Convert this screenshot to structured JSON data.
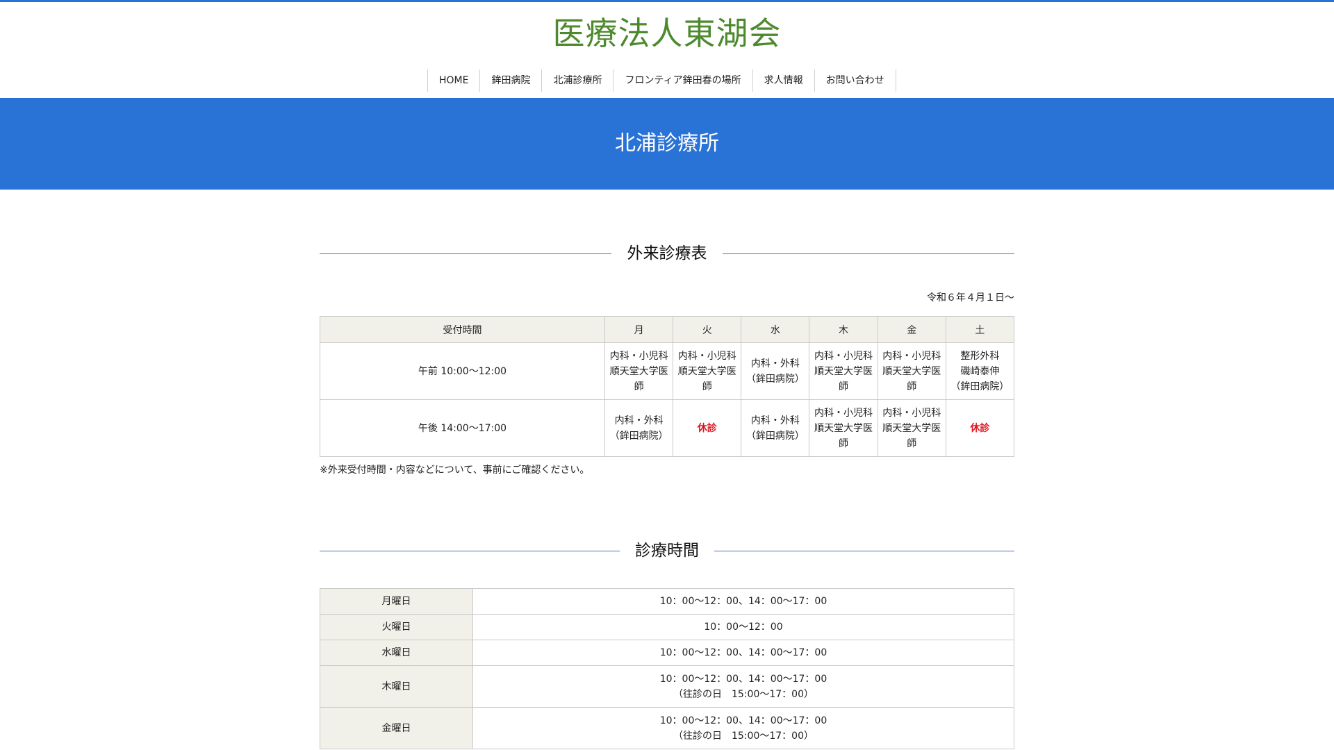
{
  "site": {
    "logo": "医療法人東湖会"
  },
  "nav": [
    "HOME",
    "鉾田病院",
    "北浦診療所",
    "フロンティア鉾田春の場所",
    "求人情報",
    "お問い合わせ"
  ],
  "hero": {
    "title": "北浦診療所"
  },
  "schedule": {
    "heading": "外来診療表",
    "effective_date": "令和６年４月１日～",
    "columns": [
      "受付時間",
      "月",
      "火",
      "水",
      "木",
      "金",
      "土"
    ],
    "rows": [
      {
        "time": "午前 10:00～12:00",
        "cells": [
          {
            "text": "内科・小児科\n順天堂大学医\n師",
            "closed": false
          },
          {
            "text": "内科・小児科\n順天堂大学医\n師",
            "closed": false
          },
          {
            "text": "内科・外科\n（鉾田病院）",
            "closed": false
          },
          {
            "text": "内科・小児科\n順天堂大学医\n師",
            "closed": false
          },
          {
            "text": "内科・小児科\n順天堂大学医\n師",
            "closed": false
          },
          {
            "text": "整形外科\n磯崎泰伸\n（鉾田病院）",
            "closed": false
          }
        ]
      },
      {
        "time": "午後 14:00～17:00",
        "cells": [
          {
            "text": "内科・外科\n（鉾田病院）",
            "closed": false
          },
          {
            "text": "休診",
            "closed": true
          },
          {
            "text": "内科・外科\n（鉾田病院）",
            "closed": false
          },
          {
            "text": "内科・小児科\n順天堂大学医\n師",
            "closed": false
          },
          {
            "text": "内科・小児科\n順天堂大学医\n師",
            "closed": false
          },
          {
            "text": "休診",
            "closed": true
          }
        ]
      }
    ],
    "footnote": "※外来受付時間・内容などについて、事前にご確認ください。"
  },
  "hours": {
    "heading": "診療時間",
    "rows": [
      {
        "day": "月曜日",
        "time": "10：00～12：00、14：00～17：00"
      },
      {
        "day": "火曜日",
        "time": "10：00～12：00"
      },
      {
        "day": "水曜日",
        "time": "10：00～12：00、14：00～17：00"
      },
      {
        "day": "木曜日",
        "time": "10：00～12：00、14：00～17：00\n（往診の日　15:00～17：00）"
      },
      {
        "day": "金曜日",
        "time": "10：00～12：00、14：00～17：00\n（往診の日　15:00～17：00）"
      }
    ]
  },
  "colors": {
    "brand_blue": "#2a73d6",
    "logo_green": "#4d8a2e",
    "closed_red": "#e0151e",
    "header_cell": "#f2f1e9"
  }
}
